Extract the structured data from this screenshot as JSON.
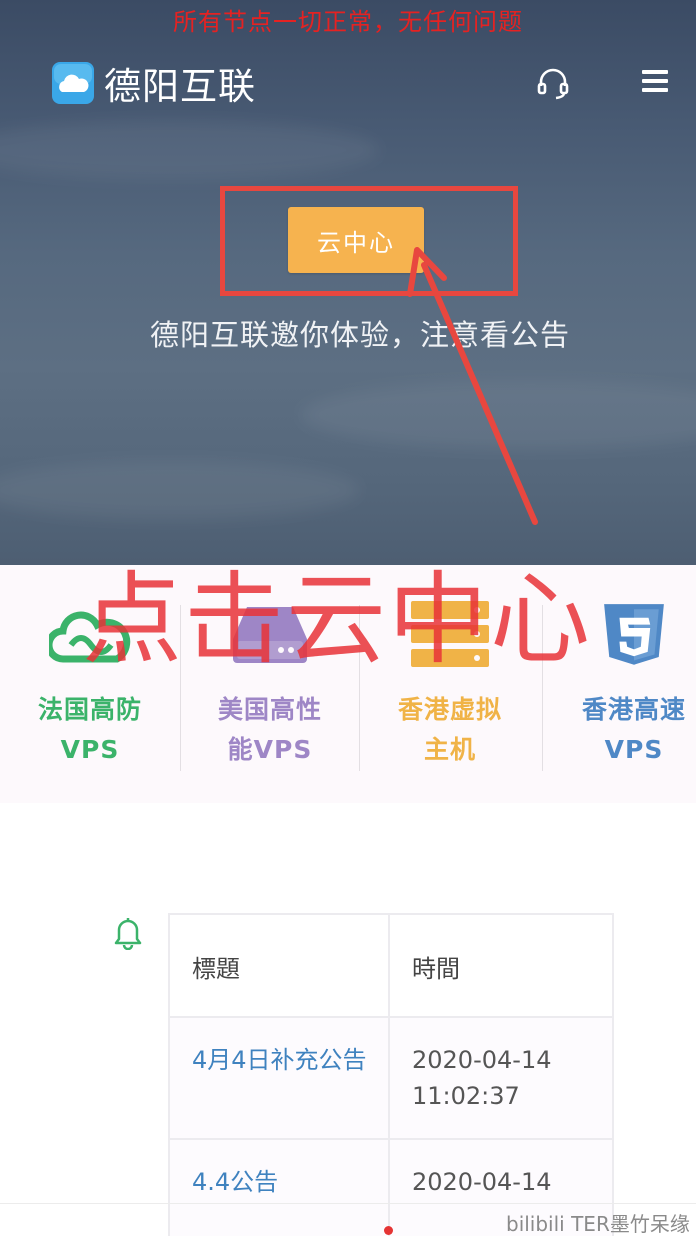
{
  "notice_banner": "所有节点一切正常，无任何问题",
  "header": {
    "brand_name": "德阳互联",
    "icons": [
      "cloud-logo-icon",
      "headset-icon",
      "menu-icon"
    ]
  },
  "hero": {
    "cta_button": "云中心",
    "subtitle": "德阳互联邀你体验，注意看公告"
  },
  "annotation": {
    "overlay_text": "点击云中心",
    "color": "#e8473f"
  },
  "products": [
    {
      "line1": "法国高防",
      "line2": "VPS",
      "color": "#3bb36a",
      "icon": "cloud-infinity-icon"
    },
    {
      "line1": "美国高性",
      "line2": "能VPS",
      "color": "#9e86c6",
      "icon": "hard-drive-icon"
    },
    {
      "line1": "香港虚拟",
      "line2": "主机",
      "color": "#f0b347",
      "icon": "server-stack-icon"
    },
    {
      "line1": "香港高速",
      "line2": "VPS",
      "color": "#4f88c6",
      "icon": "html5-icon"
    }
  ],
  "announcements": {
    "icon": "bell-icon",
    "columns": [
      "標題",
      "時間"
    ],
    "rows": [
      {
        "title": "4月4日补充公告",
        "time": "2020-04-14 11:02:37"
      },
      {
        "title": "4.4公告",
        "time": "2020-04-14"
      }
    ]
  },
  "watermark": "bilibili TER墨竹呆缘",
  "colors": {
    "accent_button": "#f6b34f",
    "link": "#3f82bf",
    "page_dot": "#e53434"
  }
}
